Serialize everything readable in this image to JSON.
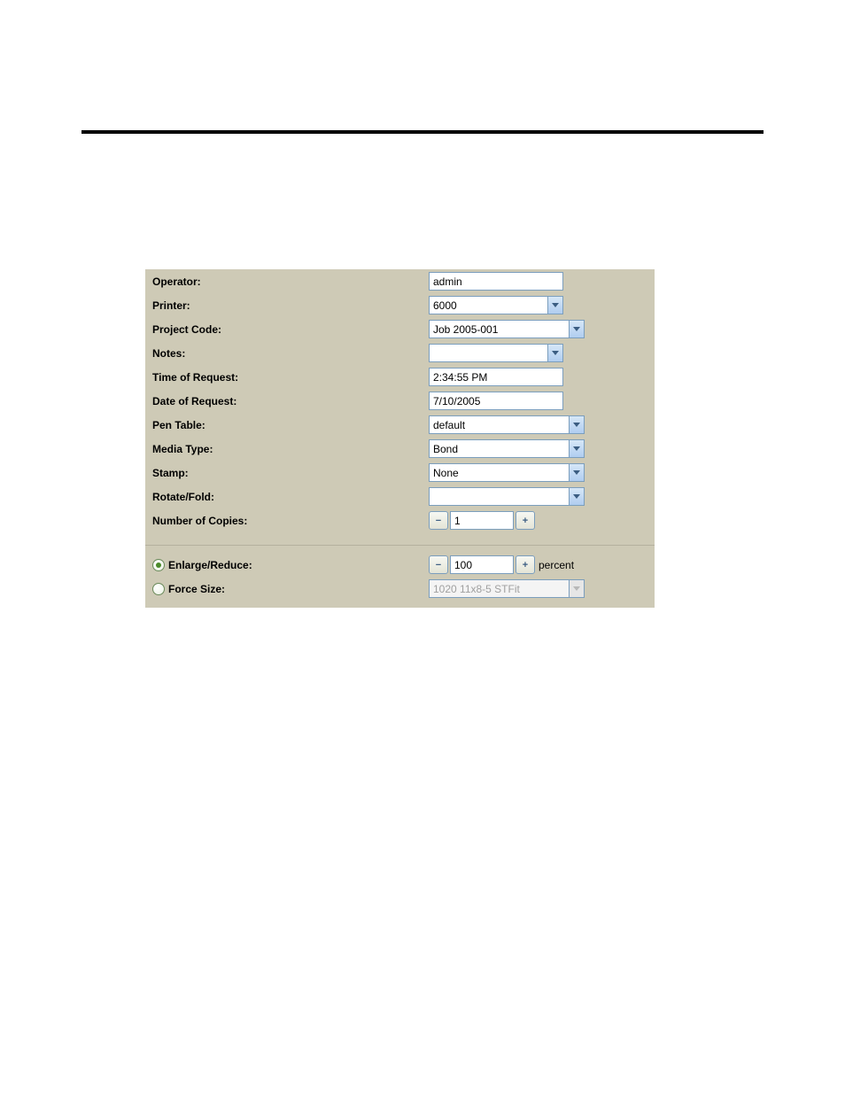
{
  "form": {
    "operator": {
      "label": "Operator:",
      "value": "admin"
    },
    "printer": {
      "label": "Printer:",
      "value": "6000"
    },
    "project_code": {
      "label": "Project Code:",
      "value": "Job 2005-001"
    },
    "notes": {
      "label": "Notes:",
      "value": ""
    },
    "time_of_request": {
      "label": "Time of Request:",
      "value": "2:34:55 PM"
    },
    "date_of_request": {
      "label": "Date of Request:",
      "value": "7/10/2005"
    },
    "pen_table": {
      "label": "Pen Table:",
      "value": "default"
    },
    "media_type": {
      "label": "Media Type:",
      "value": "Bond"
    },
    "stamp": {
      "label": "Stamp:",
      "value": "None"
    },
    "rotate_fold": {
      "label": "Rotate/Fold:",
      "value": ""
    },
    "copies": {
      "label": "Number of Copies:",
      "value": "1"
    },
    "enlarge_reduce": {
      "label": "Enlarge/Reduce:",
      "value": "100",
      "suffix": "percent"
    },
    "force_size": {
      "label": "Force Size:",
      "value": "1020 11x8-5 STFit"
    }
  },
  "icons": {
    "minus": "−",
    "plus": "+"
  }
}
